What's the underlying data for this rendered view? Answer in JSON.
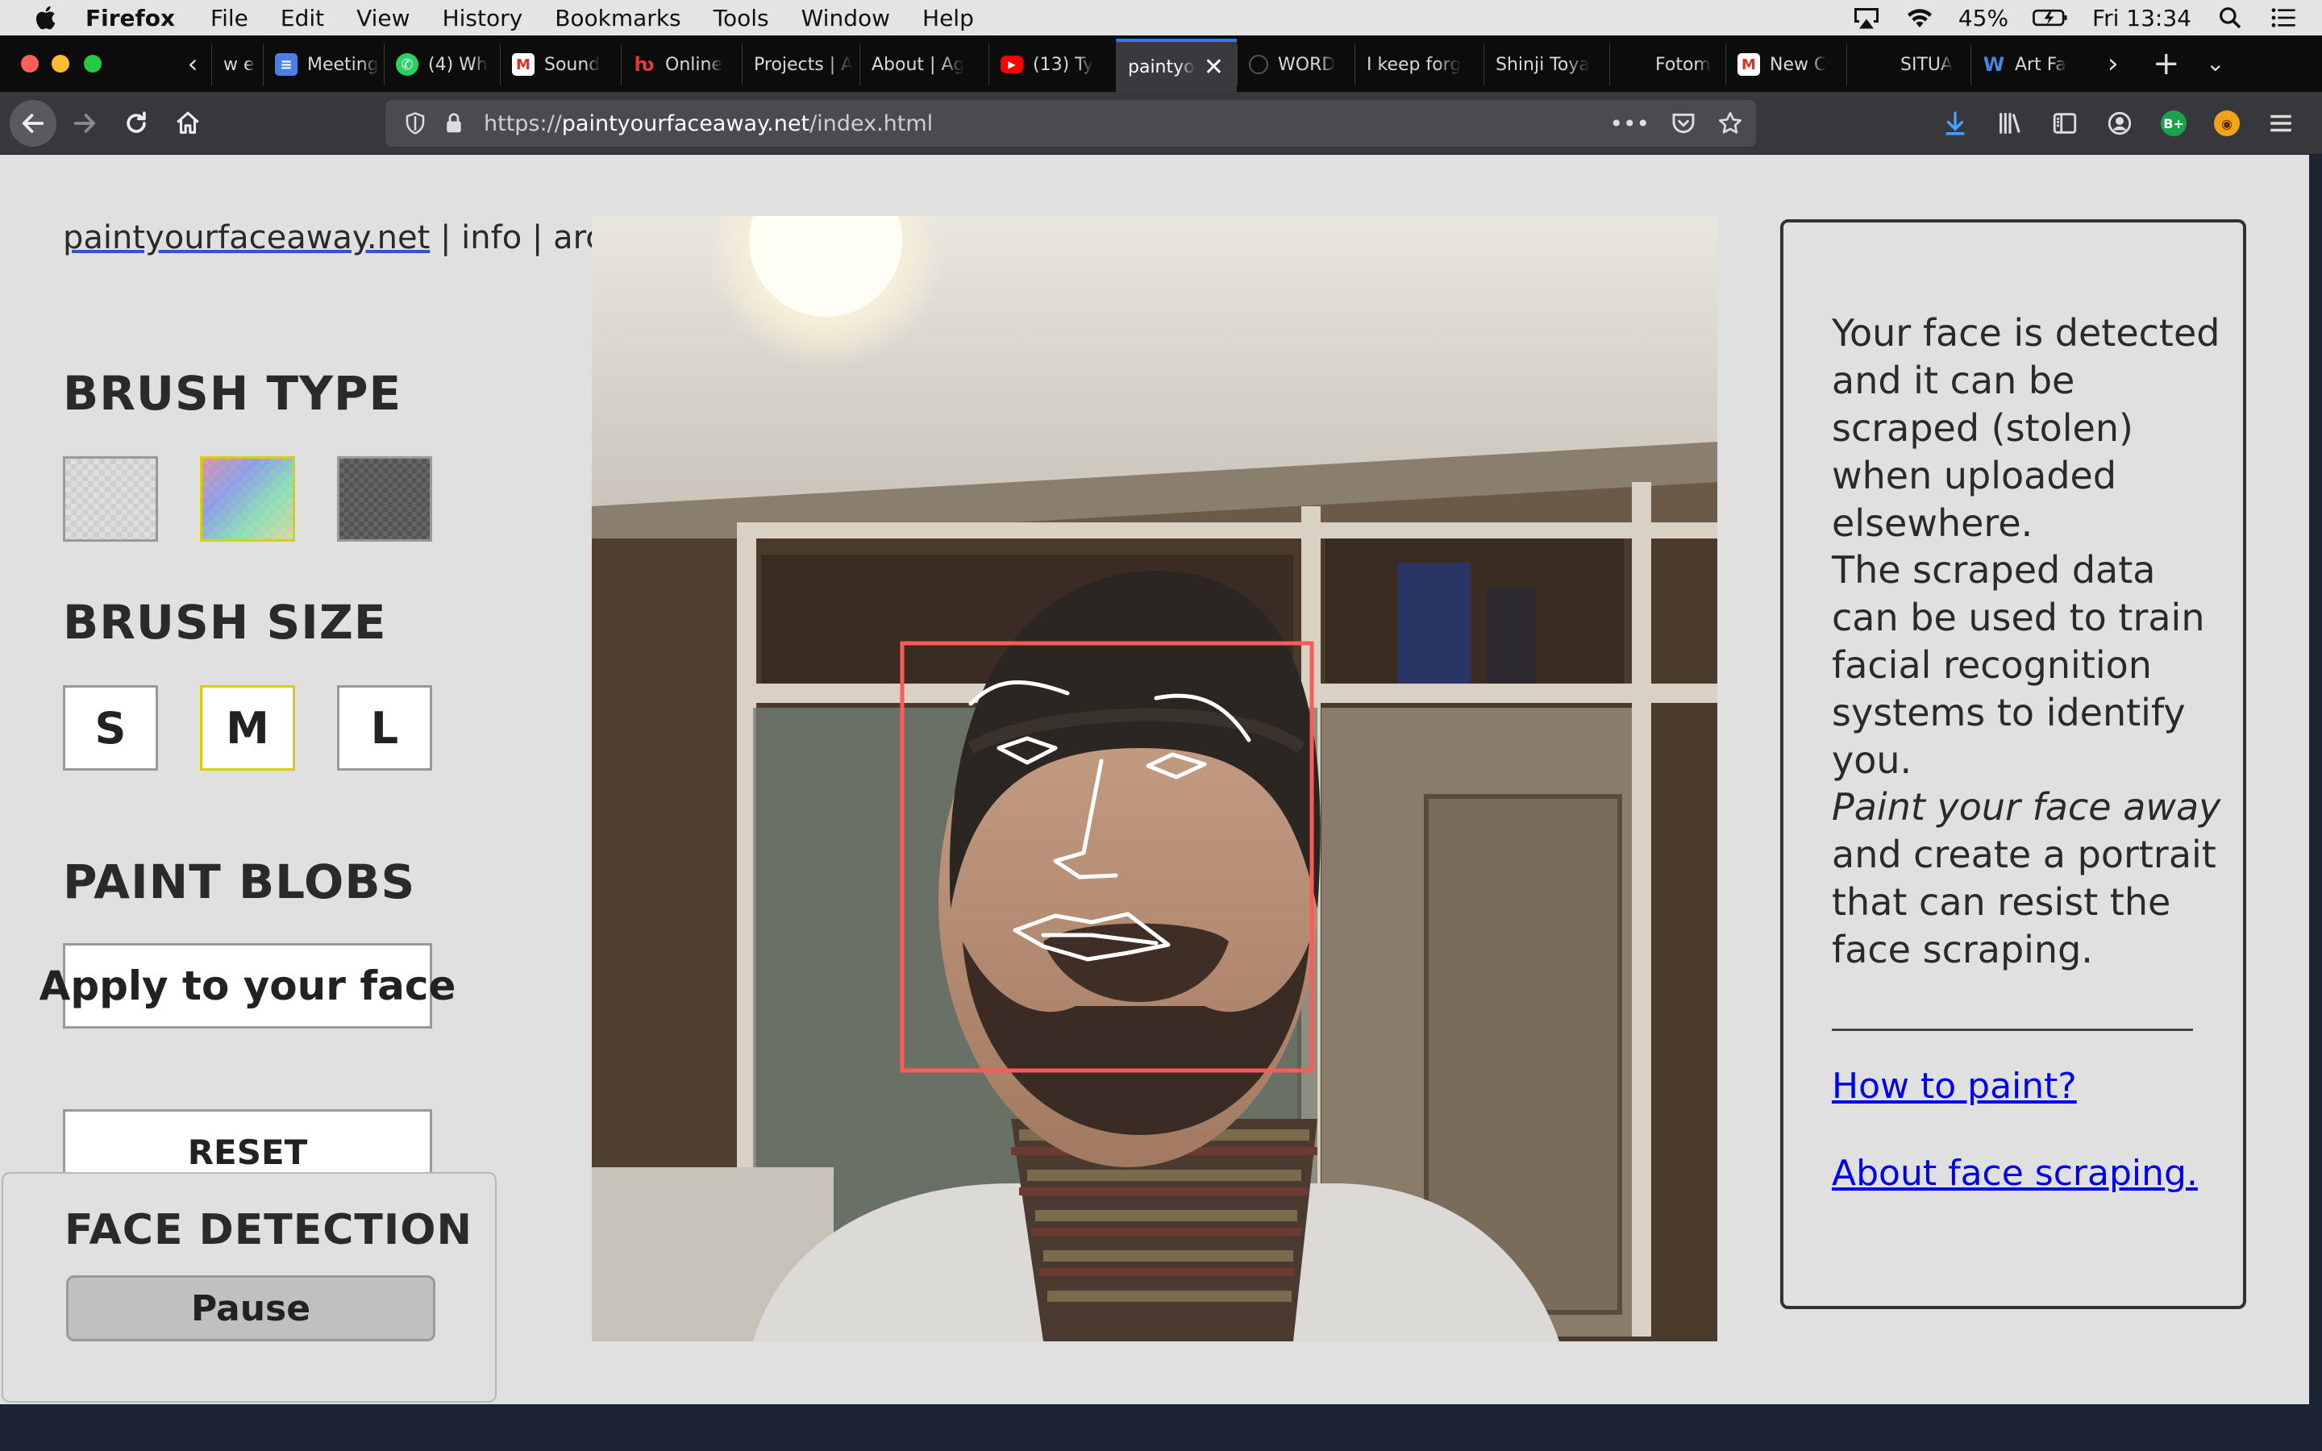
{
  "menubar": {
    "app_name": "Firefox",
    "items": [
      "File",
      "Edit",
      "View",
      "History",
      "Bookmarks",
      "Tools",
      "Window",
      "Help"
    ],
    "battery": "45%",
    "clock": "Fri 13:34"
  },
  "tabs": [
    {
      "label": "w e",
      "icon": "generic-icon"
    },
    {
      "label": "Meeting",
      "icon": "google-docs-icon",
      "color": "#4a7fe5"
    },
    {
      "label": "(4) Wh",
      "icon": "whatsapp-icon",
      "color": "#25d366"
    },
    {
      "label": "Sound",
      "icon": "gmail-icon",
      "color": "#d93025"
    },
    {
      "label": "Online",
      "icon": "online-icon",
      "color": "#e0393e"
    },
    {
      "label": "Projects | A",
      "icon": "none"
    },
    {
      "label": "About | Ag",
      "icon": "none"
    },
    {
      "label": "(13) Ty",
      "icon": "youtube-icon",
      "color": "#ff0000"
    },
    {
      "label": "paintyo",
      "icon": "none",
      "active": true
    },
    {
      "label": "WORD",
      "icon": "generic-icon"
    },
    {
      "label": "I keep forg",
      "icon": "none"
    },
    {
      "label": "Shinji Toya",
      "icon": "none"
    },
    {
      "label": "Fotom",
      "icon": "none"
    },
    {
      "label": "New C",
      "icon": "gmail-icon",
      "color": "#d93025"
    },
    {
      "label": "SITUA",
      "icon": "none"
    },
    {
      "label": "Art Fa",
      "icon": "wordpress-icon",
      "color": "#2b6cb0"
    }
  ],
  "urlbar": {
    "scheme": "https://",
    "host": "paintyourfaceaway.net",
    "path": "/index.html"
  },
  "page": {
    "nav": {
      "home": "paintyourfaceaway.net",
      "sep1": " | ",
      "info": "info",
      "sep2": " | ",
      "archive": "archive"
    },
    "brush_type": {
      "heading": "BRUSH TYPE",
      "selected": 2
    },
    "brush_size": {
      "heading": "BRUSH SIZE",
      "options": [
        "S",
        "M",
        "L"
      ],
      "selected": "M"
    },
    "paint_blobs": {
      "heading": "PAINT BLOBS",
      "apply_label": "Apply to your face"
    },
    "reset_label": "RESET",
    "face_detection": {
      "heading": "FACE DETECTION",
      "pause_label": "Pause"
    },
    "info": {
      "p1": "Your face is detected and it can be scraped (stolen) when uploaded elsewhere.",
      "p2": "The scraped data can be used to train facial recognition systems to identify you.",
      "p3_em": "Paint your face away",
      "p3_rest": " and create a portrait that can resist the face scraping.",
      "link1": "How to paint?",
      "link2": "About face scraping."
    }
  },
  "colors": {
    "accent_selected": "#d9d000",
    "face_box": "#ff5a5a",
    "landmarks": "#ffffff",
    "link": "#0000ee"
  }
}
